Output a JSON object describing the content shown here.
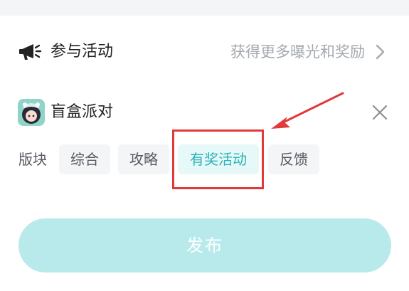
{
  "activity": {
    "title": "参与活动",
    "hint": "获得更多曝光和奖励",
    "icon": "megaphone-icon"
  },
  "game": {
    "name": "盲盒派对",
    "icon": "game-avatar-icon"
  },
  "section": {
    "label": "版块",
    "chips": [
      {
        "label": "综合",
        "selected": false
      },
      {
        "label": "攻略",
        "selected": false
      },
      {
        "label": "有奖活动",
        "selected": true
      },
      {
        "label": "反馈",
        "selected": false
      }
    ]
  },
  "publish": {
    "label": "发布"
  },
  "colors": {
    "accent": "#2bb3b9",
    "accent_bg": "#e6f8f8",
    "publish_bg": "#b8eaec",
    "annotation": "#e23a3a",
    "hint_text": "#a4a9ae"
  }
}
